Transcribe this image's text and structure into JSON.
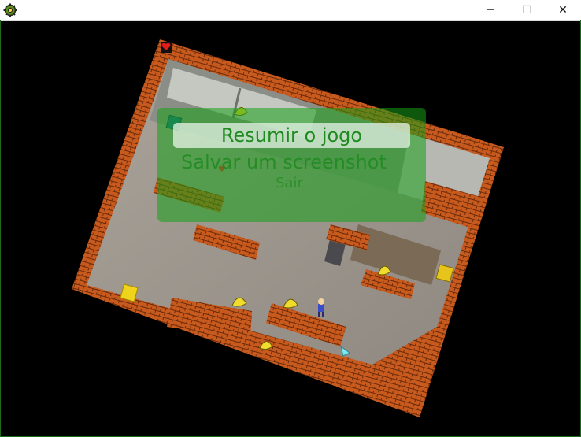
{
  "window": {
    "minimize_glyph": "─",
    "maximize_glyph": "☐",
    "close_glyph": "✕",
    "icon": "gear-icon"
  },
  "menu": {
    "items": [
      {
        "label": "Resumir o jogo",
        "selected": true
      },
      {
        "label": "Salvar um screenshot",
        "selected": false
      },
      {
        "label": "Sair",
        "selected": false
      }
    ]
  },
  "colors": {
    "brick": "#c85a1e",
    "floor": "#9b958d",
    "background": "#000000",
    "menu_panel": "#18a018",
    "menu_text": "#1f8a1f"
  }
}
